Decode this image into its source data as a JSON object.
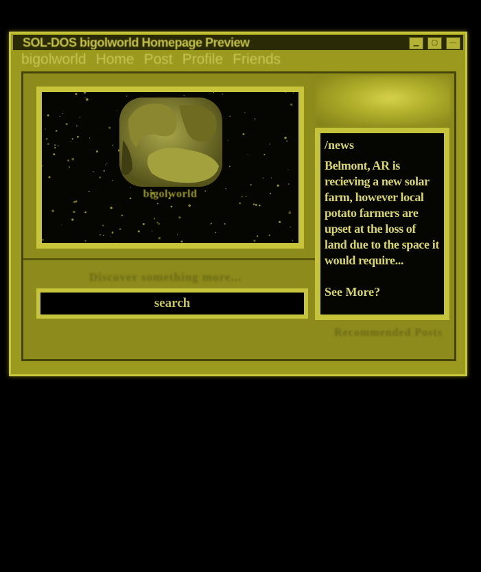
{
  "window": {
    "title": "SOL-DOS bigolworld Homepage Preview",
    "buttons": [
      "minimize",
      "maximize",
      "close"
    ]
  },
  "menu": {
    "items": [
      "bigolworld",
      "Home",
      "Post",
      "Profile",
      "Friends"
    ]
  },
  "banner": {
    "logo_text": "bigolworld"
  },
  "search": {
    "prompt": "Discover something more...",
    "placeholder": "search"
  },
  "news": {
    "heading": "/news",
    "body": "Belmont, AR is recieving a new solar farm, however local potato farmers are upset at the loss of land due to the space it would require...",
    "more": "See More?"
  },
  "recommended": {
    "label": "Recommended Posts"
  },
  "colors": {
    "background": "#000000",
    "window": "#9b9a1f",
    "titlebar": "#2a2a06",
    "accent_text": "#c9c74a"
  },
  "icons": {
    "minimize": "minimize-icon",
    "maximize": "maximize-icon",
    "close": "close-icon"
  }
}
